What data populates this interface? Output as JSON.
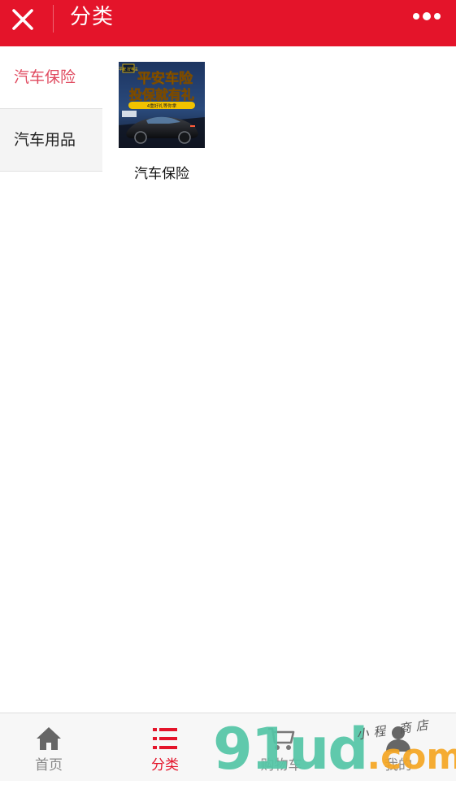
{
  "header": {
    "title": "分类"
  },
  "sidebar": {
    "items": [
      {
        "label": "汽车保险",
        "active": true
      },
      {
        "label": "汽车用品",
        "active": false
      }
    ]
  },
  "content": {
    "products": [
      {
        "name": "汽车保险",
        "thumb_badge": "平安 好车主",
        "thumb_line1": "平安车险",
        "thumb_line2": "投保就有礼",
        "thumb_ribbon": "4重好礼等你拿"
      }
    ]
  },
  "tabbar": {
    "items": [
      {
        "label": "首页",
        "icon": "home-icon",
        "active": false
      },
      {
        "label": "分类",
        "icon": "list-icon",
        "active": true
      },
      {
        "label": "购物车",
        "icon": "cart-icon",
        "active": false
      },
      {
        "label": "我的",
        "icon": "user-icon",
        "active": false
      }
    ]
  },
  "watermark": {
    "text": "91ud",
    "domain": ".com",
    "signature": "小程 商店"
  },
  "colors": {
    "brand_red": "#e4142a",
    "active_category": "#e04a5f",
    "inactive_tab": "#888888",
    "watermark_green": "#54c6a6",
    "watermark_orange": "#f5a623"
  }
}
